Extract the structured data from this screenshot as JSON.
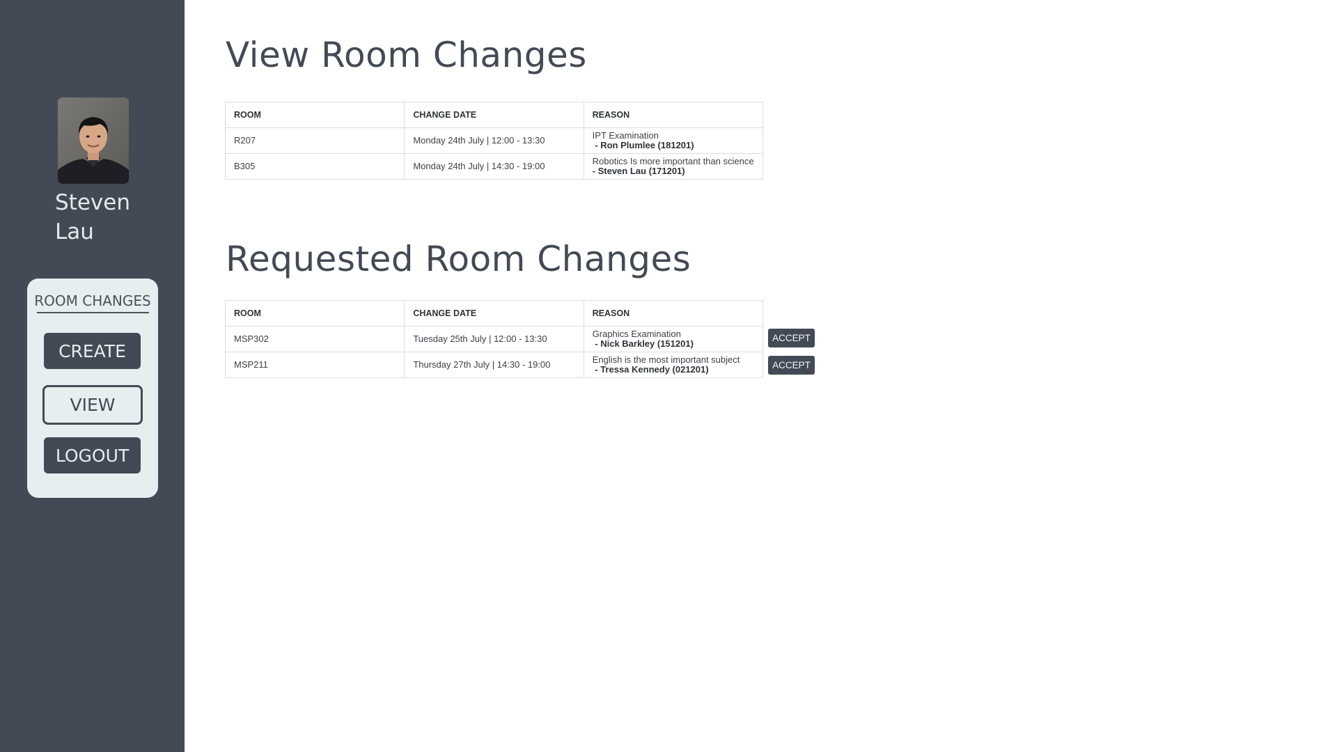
{
  "user": {
    "name": "Steven Lau"
  },
  "nav": {
    "heading": "ROOM CHANGES",
    "create_label": "CREATE",
    "view_label": "VIEW",
    "logout_label": "LOGOUT"
  },
  "view_section": {
    "title": "View Room Changes",
    "columns": [
      "ROOM",
      "CHANGE DATE",
      "REASON"
    ],
    "rows": [
      {
        "room": "R207",
        "date": "Monday 24th July | 12:00 - 13:30",
        "reason": "IPT Examination",
        "by": " - Ron Plumlee (181201)"
      },
      {
        "room": "B305",
        "date": "Monday 24th July | 14:30 - 19:00",
        "reason": "Robotics Is more important than science",
        "by": "- Steven Lau (171201)"
      }
    ]
  },
  "requested_section": {
    "title": "Requested Room Changes",
    "columns": [
      "ROOM",
      "CHANGE DATE",
      "REASON"
    ],
    "rows": [
      {
        "room": "MSP302",
        "date": "Tuesday 25th July | 12:00 - 13:30",
        "reason": "Graphics Examination",
        "by": " - Nick Barkley (151201)",
        "action": "ACCEPT"
      },
      {
        "room": "MSP211",
        "date": "Thursday 27th July | 14:30 - 19:00",
        "reason": "English is the most important subject",
        "by": " - Tressa Kennedy (021201)",
        "action": "ACCEPT"
      }
    ]
  },
  "colors": {
    "sidebar_bg": "#434a55",
    "nav_card_bg": "#e6eeef",
    "accent": "#434a55"
  },
  "icons": {
    "avatar": "user-profile-photo"
  }
}
